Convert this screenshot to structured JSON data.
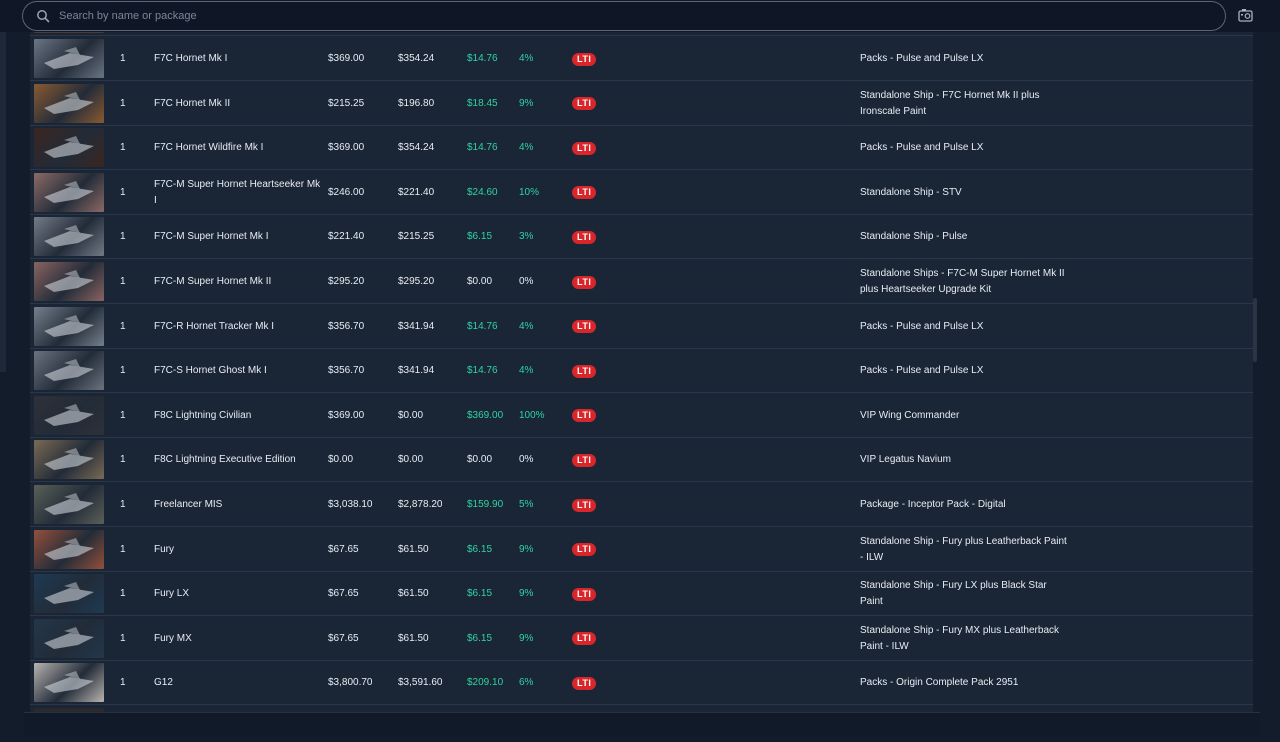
{
  "search": {
    "placeholder": "Search by name or package"
  },
  "icons": {
    "search": "search-icon",
    "screenshot": "camera-icon"
  },
  "colors": {
    "saving": "#2fd4a4",
    "lti_badge": "#d9262b",
    "background": "#1a2535"
  },
  "rows": [
    {
      "qty": "1",
      "name": "F7C Hornet Mk I",
      "original": "$369.00",
      "current": "$354.24",
      "saving": "$14.76",
      "saving_pct": "4%",
      "insurance": "LTI",
      "package": "Packs - Pulse and Pulse LX",
      "highlight": true,
      "thumb": "#6b7583"
    },
    {
      "qty": "1",
      "name": "F7C Hornet Mk II",
      "original": "$215.25",
      "current": "$196.80",
      "saving": "$18.45",
      "saving_pct": "9%",
      "insurance": "LTI",
      "package": "Standalone Ship - F7C Hornet Mk II plus Ironscale Paint",
      "highlight": true,
      "thumb": "#8a5a32"
    },
    {
      "qty": "1",
      "name": "F7C Hornet Wildfire Mk I",
      "original": "$369.00",
      "current": "$354.24",
      "saving": "$14.76",
      "saving_pct": "4%",
      "insurance": "LTI",
      "package": "Packs - Pulse and Pulse LX",
      "highlight": true,
      "thumb": "#3a2620"
    },
    {
      "qty": "1",
      "name": "F7C-M Super Hornet Heartseeker Mk I",
      "original": "$246.00",
      "current": "$221.40",
      "saving": "$24.60",
      "saving_pct": "10%",
      "insurance": "LTI",
      "package": "Standalone Ship - STV",
      "highlight": true,
      "thumb": "#8c6a66"
    },
    {
      "qty": "1",
      "name": "F7C-M Super Hornet Mk I",
      "original": "$221.40",
      "current": "$215.25",
      "saving": "$6.15",
      "saving_pct": "3%",
      "insurance": "LTI",
      "package": "Standalone Ship - Pulse",
      "highlight": true,
      "thumb": "#737b86"
    },
    {
      "qty": "1",
      "name": "F7C-M Super Hornet Mk II",
      "original": "$295.20",
      "current": "$295.20",
      "saving": "$0.00",
      "saving_pct": "0%",
      "insurance": "LTI",
      "package": "Standalone Ships - F7C-M Super Hornet Mk II plus Heartseeker Upgrade Kit",
      "highlight": false,
      "thumb": "#8a6460"
    },
    {
      "qty": "1",
      "name": "F7C-R Hornet Tracker Mk I",
      "original": "$356.70",
      "current": "$341.94",
      "saving": "$14.76",
      "saving_pct": "4%",
      "insurance": "LTI",
      "package": "Packs - Pulse and Pulse LX",
      "highlight": true,
      "thumb": "#76808c"
    },
    {
      "qty": "1",
      "name": "F7C-S Hornet Ghost Mk I",
      "original": "$356.70",
      "current": "$341.94",
      "saving": "$14.76",
      "saving_pct": "4%",
      "insurance": "LTI",
      "package": "Packs - Pulse and Pulse LX",
      "highlight": true,
      "thumb": "#6a737e"
    },
    {
      "qty": "1",
      "name": "F8C Lightning Civilian",
      "original": "$369.00",
      "current": "$0.00",
      "saving": "$369.00",
      "saving_pct": "100%",
      "insurance": "LTI",
      "package": "VIP Wing Commander",
      "highlight": true,
      "thumb": "#2e3138"
    },
    {
      "qty": "1",
      "name": "F8C Lightning Executive Edition",
      "original": "$0.00",
      "current": "$0.00",
      "saving": "$0.00",
      "saving_pct": "0%",
      "insurance": "LTI",
      "package": "VIP Legatus Navium",
      "highlight": false,
      "thumb": "#7a6a55"
    },
    {
      "qty": "1",
      "name": "Freelancer MIS",
      "original": "$3,038.10",
      "current": "$2,878.20",
      "saving": "$159.90",
      "saving_pct": "5%",
      "insurance": "LTI",
      "package": "Package - Inceptor Pack - Digital",
      "highlight": true,
      "thumb": "#5a6058"
    },
    {
      "qty": "1",
      "name": "Fury",
      "original": "$67.65",
      "current": "$61.50",
      "saving": "$6.15",
      "saving_pct": "9%",
      "insurance": "LTI",
      "package": "Standalone Ship - Fury plus Leatherback Paint - ILW",
      "highlight": true,
      "thumb": "#94503a"
    },
    {
      "qty": "1",
      "name": "Fury LX",
      "original": "$67.65",
      "current": "$61.50",
      "saving": "$6.15",
      "saving_pct": "9%",
      "insurance": "LTI",
      "package": "Standalone Ship - Fury LX plus Black Star Paint",
      "highlight": true,
      "thumb": "#1e3a52"
    },
    {
      "qty": "1",
      "name": "Fury MX",
      "original": "$67.65",
      "current": "$61.50",
      "saving": "$6.15",
      "saving_pct": "9%",
      "insurance": "LTI",
      "package": "Standalone Ship - Fury MX plus Leatherback Paint - ILW",
      "highlight": true,
      "thumb": "#23374a"
    },
    {
      "qty": "1",
      "name": "G12",
      "original": "$3,800.70",
      "current": "$3,591.60",
      "saving": "$209.10",
      "saving_pct": "6%",
      "insurance": "LTI",
      "package": "Packs - Origin Complete Pack 2951",
      "highlight": true,
      "thumb": "#b8b4b0"
    }
  ]
}
